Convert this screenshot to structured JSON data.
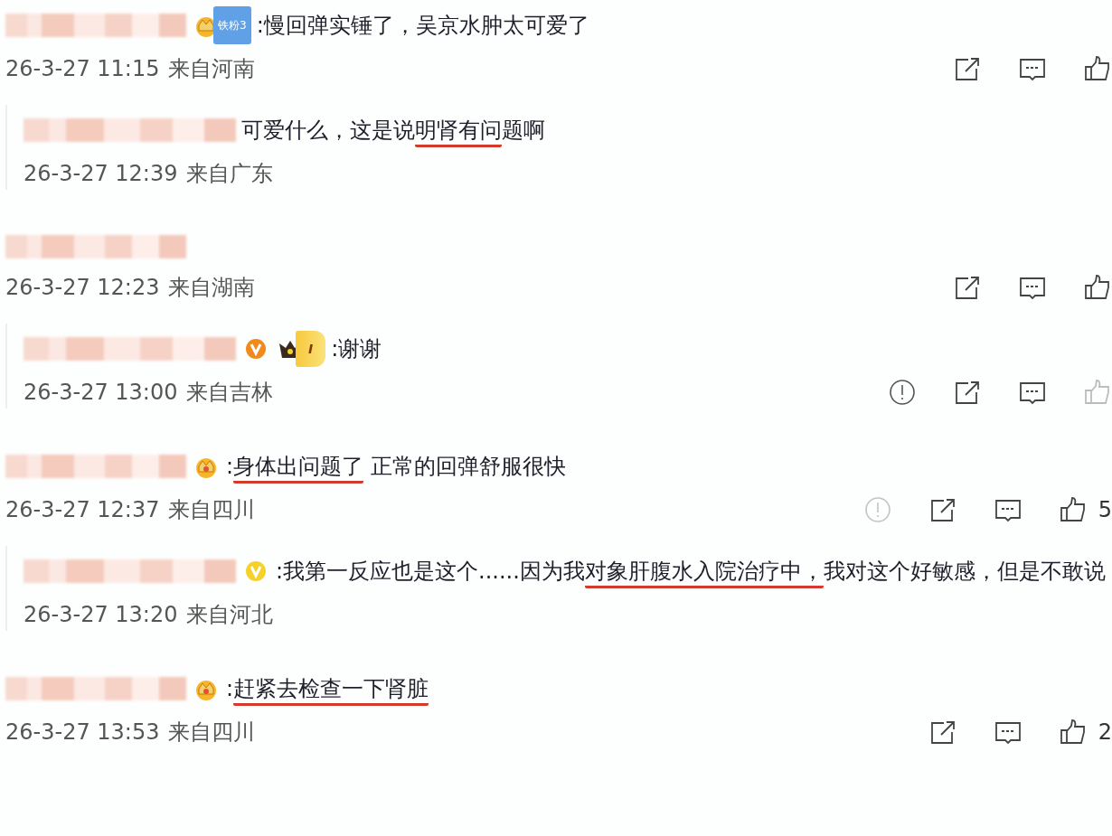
{
  "comments": [
    {
      "kind": "top",
      "badges": [
        {
          "kind": "fan",
          "text": "铁粉3"
        }
      ],
      "segments": [
        {
          "text": ":慢回弹实锤了，吴京水肿太可爱了",
          "underlined": false
        }
      ],
      "time": "26-3-27 11:15",
      "location": "来自河南",
      "actions": [
        {
          "kind": "share",
          "dimmed": false
        },
        {
          "kind": "comment",
          "dimmed": false
        },
        {
          "kind": "like",
          "dimmed": false
        }
      ]
    },
    {
      "kind": "reply",
      "segments": [
        {
          "text": "可爱什么，这是说",
          "underlined": false
        },
        {
          "text": "明肾有问",
          "underlined": true
        },
        {
          "text": "题啊",
          "underlined": false
        }
      ],
      "time": "26-3-27 12:39",
      "location": "来自广东"
    },
    {
      "kind": "top",
      "time": "26-3-27 12:23",
      "location": "来自湖南",
      "actions": [
        {
          "kind": "share",
          "dimmed": false
        },
        {
          "kind": "comment",
          "dimmed": false
        },
        {
          "kind": "like",
          "dimmed": false
        }
      ]
    },
    {
      "kind": "reply",
      "badges": [
        {
          "kind": "vip"
        },
        {
          "kind": "level",
          "text": "I"
        }
      ],
      "segments": [
        {
          "text": ":谢谢",
          "underlined": false
        }
      ],
      "time": "26-3-27 13:00",
      "location": "来自吉林",
      "actions": [
        {
          "kind": "report",
          "dimmed": false
        },
        {
          "kind": "share",
          "dimmed": false
        },
        {
          "kind": "comment",
          "dimmed": false
        },
        {
          "kind": "like",
          "dimmed": true
        }
      ]
    },
    {
      "kind": "top",
      "badges": [
        {
          "kind": "crown"
        }
      ],
      "segments": [
        {
          "text": ":",
          "underlined": false
        },
        {
          "text": "身体出问题了",
          "underlined": true
        },
        {
          "text": " 正常的回弹舒服很快",
          "underlined": false
        }
      ],
      "time": "26-3-27 12:37",
      "location": "来自四川",
      "actions": [
        {
          "kind": "report",
          "dimmed": true
        },
        {
          "kind": "share",
          "dimmed": false
        },
        {
          "kind": "comment",
          "dimmed": false
        },
        {
          "kind": "like",
          "dimmed": false
        }
      ],
      "likes": "5"
    },
    {
      "kind": "reply",
      "badges": [
        {
          "kind": "vip-gold"
        }
      ],
      "segments": [
        {
          "text": ":我第一反应也是这个......因为我",
          "underlined": false
        },
        {
          "text": "对象肝腹水入院治疗中，",
          "underlined": true
        },
        {
          "text": "我对这个好敏感，但是不敢说",
          "underlined": false
        }
      ],
      "time": "26-3-27 13:20",
      "location": "来自河北"
    },
    {
      "kind": "top",
      "badges": [
        {
          "kind": "crown"
        }
      ],
      "segments": [
        {
          "text": ":",
          "underlined": false
        },
        {
          "text": "赶紧去检查一下肾脏",
          "underlined": true
        }
      ],
      "time": "26-3-27 13:53",
      "location": "来自四川",
      "actions": [
        {
          "kind": "share",
          "dimmed": false
        },
        {
          "kind": "comment",
          "dimmed": false
        },
        {
          "kind": "like",
          "dimmed": false
        }
      ],
      "likes": "2"
    }
  ]
}
